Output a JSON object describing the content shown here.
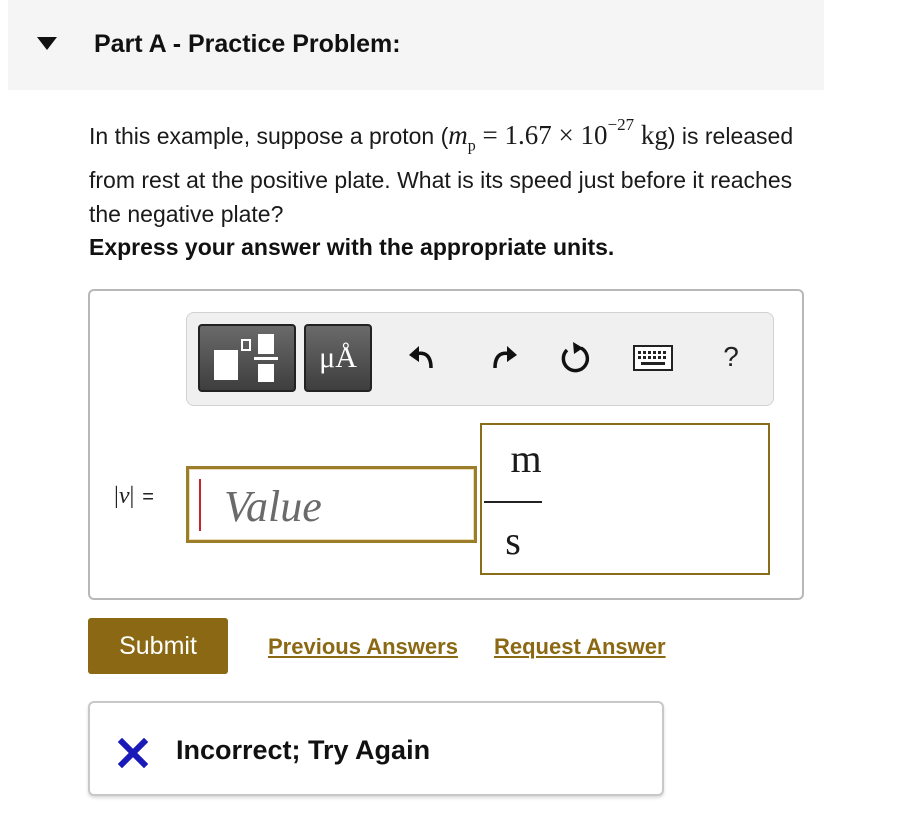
{
  "part": {
    "title": "Part A - Practice Problem:"
  },
  "question": {
    "text_before": "In this example, suppose a proton (",
    "mass_symbol": "m",
    "mass_subscript": "p",
    "mass_equals": " = 1.67 × 10",
    "mass_exponent": "−27",
    "mass_unit": " kg",
    "text_after": ") is released from rest at the positive plate. What is its speed just before it reaches the negative plate?"
  },
  "instruction": "Express your answer with the appropriate units.",
  "toolbar": {
    "templates_icon": "templates-icon",
    "units_label": "μÅ",
    "undo_icon": "undo-icon",
    "redo_icon": "redo-icon",
    "reset_icon": "reset-icon",
    "keyboard_icon": "keyboard-icon",
    "help_label": "?"
  },
  "answer": {
    "variable": "v",
    "equals": "=",
    "value_placeholder": "Value",
    "unit_numerator": "m",
    "unit_denominator": "s"
  },
  "actions": {
    "submit_label": "Submit",
    "previous_answers_label": "Previous Answers",
    "request_answer_label": "Request Answer"
  },
  "feedback": {
    "icon": "x-icon",
    "text": "Incorrect; Try Again"
  },
  "colors": {
    "accent": "#8b6914",
    "header_bg": "#f5f5f5",
    "incorrect": "#1a1ab8",
    "cursor": "#c1272d"
  }
}
